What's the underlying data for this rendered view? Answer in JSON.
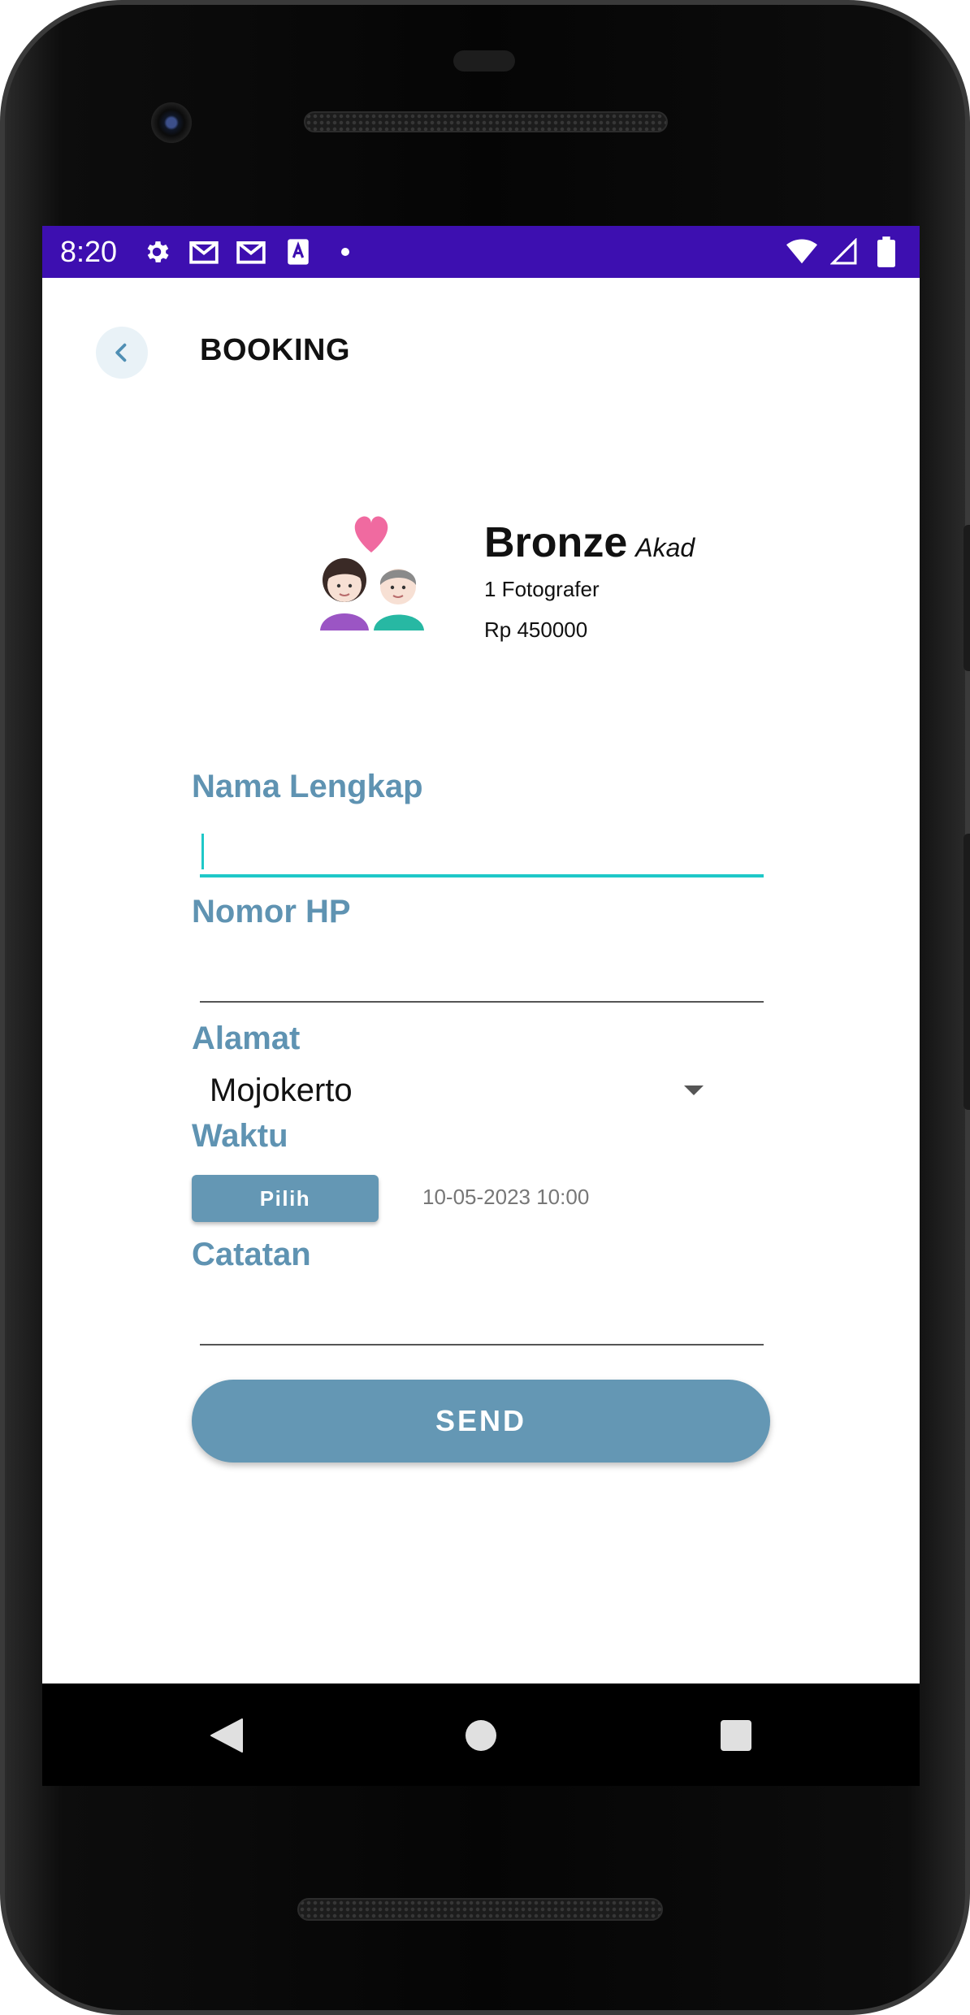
{
  "status_bar": {
    "time": "8:20",
    "left_icons": [
      "gear-icon",
      "gmail-icon",
      "gmail-icon",
      "keyboard-a-icon",
      "dot-icon"
    ],
    "right_icons": [
      "wifi-icon",
      "signal-icon",
      "battery-icon"
    ],
    "background_color": "#3d0fb0"
  },
  "app_bar": {
    "title": "BOOKING",
    "back_icon": "chevron-left-icon"
  },
  "package": {
    "icon": "couple-with-heart-icon",
    "name": "Bronze",
    "type": "Akad",
    "photographer": "1 Fotografer",
    "price": "Rp 450000"
  },
  "form": {
    "full_name": {
      "label": "Nama Lengkap",
      "value": ""
    },
    "phone": {
      "label": "Nomor HP",
      "value": ""
    },
    "address": {
      "label": "Alamat",
      "selected": "Mojokerto"
    },
    "time": {
      "label": "Waktu",
      "button_label": "Pilih",
      "value": "10-05-2023 10:00"
    },
    "notes": {
      "label": "Catatan",
      "value": ""
    },
    "send_label": "SEND"
  },
  "colors": {
    "accent": "#6497b4",
    "focus": "#1fc8c8",
    "label": "#5f93b2"
  },
  "nav_bar": {
    "items": [
      "back-triangle-icon",
      "home-circle-icon",
      "recents-square-icon"
    ]
  }
}
